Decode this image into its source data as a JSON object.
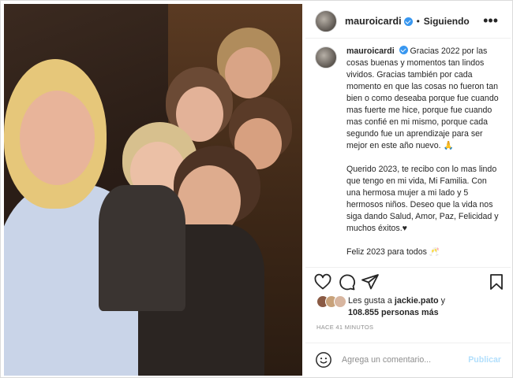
{
  "header": {
    "username": "mauroicardi",
    "separator": "•",
    "follow_label": "Siguiendo",
    "more_icon": "•••"
  },
  "caption": {
    "username": "mauroicardi",
    "paragraphs": [
      "Gracias 2022 por las cosas buenas y momentos tan lindos vividos. Gracias también por cada momento en que las cosas no fueron tan bien o como deseaba porque fue cuando mas fuerte me hice, porque fue cuando mas confié en mi mismo, porque cada segundo fue un aprendizaje para ser mejor en este año nuevo. 🙏",
      "Querido 2023, te recibo con lo mas lindo que tengo en mi vida, Mi Familia. Con una hermosa mujer a mi lado y 5 hermosos niños. Deseo que la vida nos siga dando Salud, Amor, Paz, Felicidad y muchos éxitos.♥",
      "Feliz 2023 para todos 🥂"
    ]
  },
  "actions": {
    "like_icon": "heart-icon",
    "comment_icon": "comment-icon",
    "share_icon": "share-icon",
    "save_icon": "bookmark-icon"
  },
  "likes": {
    "prefix": "Les gusta a",
    "user": "jackie.pato",
    "connector": "y",
    "count": "108.855 personas más"
  },
  "timestamp": "HACE 41 MINUTOS",
  "comment_box": {
    "placeholder": "Agrega un comentario...",
    "publish_label": "Publicar"
  },
  "colors": {
    "verified": "#3897f0",
    "publish_disabled": "#b2dffc",
    "muted": "#8e8e8e"
  }
}
